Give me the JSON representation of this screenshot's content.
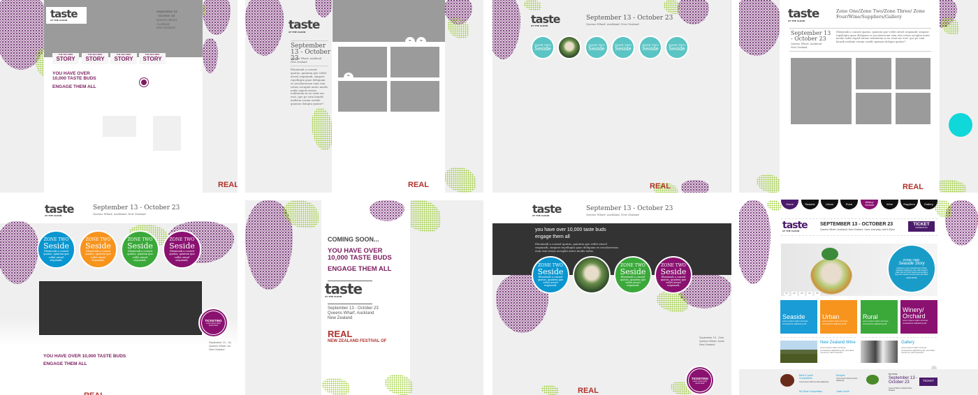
{
  "brand": {
    "logo": "taste",
    "logo_sub": "AT THE CLOUD",
    "real_logo": "REAL",
    "real_sub": "NEW ZEALAND FESTIVAL OF"
  },
  "colors": {
    "purple": "#7b1c5e",
    "blue": "#0a96d0",
    "orange": "#f7941d",
    "green": "#3aa93a",
    "magenta": "#8a1170",
    "teal": "#5bc4c4",
    "dark": "#333333"
  },
  "panel1": {
    "date_lines": [
      "September 13",
      "- October 23",
      "Queens Wharf,",
      "Auckland",
      "New Zealand"
    ],
    "tabs": [
      {
        "small": "THE SEA SIDE",
        "big": "STORY"
      },
      {
        "small": "THE SEA SIDE",
        "big": "STORY"
      },
      {
        "small": "THE SEA SIDE",
        "big": "STORY"
      },
      {
        "small": "THE SEA SIDE",
        "big": "STORY"
      }
    ],
    "headline1": "YOU HAVE OVER",
    "headline2": "10,000 TASTE BUDS",
    "headline3": "ENGAGE THEM ALL"
  },
  "panel2": {
    "date": "September 13 - October 23",
    "location": "Queens Wharf, Auckland New Zealand",
    "body": "Ebeniendi a consed quatus, quiatem que vollet atesel sequiandi, simpost repellupta quae deliquam es necaborerum eum rem rerias acruplat antes modis nobis exped exerae nobitatem in ea venit mo eost, que pe eum latarib melisim eorum eostile quamus dolupta quatur?",
    "pager": [
      "01",
      "02"
    ],
    "grid_label": "01"
  },
  "panel3": {
    "date": "September 13 - October 23",
    "location": "Queens Wharf, Auckland, New Zealand",
    "circles": [
      {
        "zone": "ZONE TWO",
        "name": "Seside"
      },
      {
        "zone": "ZONE TWO",
        "name": "Seside"
      },
      {
        "zone": "ZONE TWO",
        "name": "Seside"
      },
      {
        "zone": "ZONE TWO",
        "name": "Seside"
      },
      {
        "zone": "ZONE TWO",
        "name": "Seside"
      }
    ]
  },
  "panel4": {
    "nav": "Zone One/Zone Two/Zone Three/ Zone Four/Wine/Suppliers/Gallery",
    "date": "September 13 - October 23",
    "location": "Queens Wharf, Auckland New Zealand",
    "body": "Ebeniendi a consed quatus, quiatem que vollet atesel sequiandi, simpost repellupta quae deliquam es necaborerum eum rem rerias acruplat antes modio nobis exped exerae nobitatem in ea venit mo eost, que pe eum latarib melisim eorum eostile quamus dolupta quatur?"
  },
  "panel5": {
    "date": "September 13 - October 23",
    "location": "Queens Wharf, Auckland, New Zealand",
    "circles": [
      {
        "zone": "ZONE TWO",
        "name": "Seside",
        "desc": "Ebeniendi a consed quatus, quiatem que vollet atesel sequiandi,"
      },
      {
        "zone": "ZONE TWO",
        "name": "Seside",
        "desc": "Ebeniendi a consed quatus, quiatem que vollet atesel sequiandi,"
      },
      {
        "zone": "ZONE TWO",
        "name": "Seside",
        "desc": "Ebeniendi a consed quatus, quiatem que vollet atesel sequiandi,"
      },
      {
        "zone": "ZONE TWO",
        "name": "Seside",
        "desc": "Ebeniendi a consed quatus, quiatem que vollet atesel sequiandi,"
      }
    ],
    "ticketing": "TICKETING",
    "ticketing_sub": "Lorem ipsum dolor amunt dolor",
    "side_date": [
      "September 13 - Oc",
      "Queens Wharf, Au",
      "New Zealand"
    ],
    "headline1": "YOU HAVE OVER 10,000 TASTE BUDS",
    "headline2": "ENGAGE THEM ALL"
  },
  "panel6": {
    "coming": "COMING SOON...",
    "headline1": "YOU HAVE OVER",
    "headline2": "10,000 TASTE BUDS",
    "headline3": "ENGAGE THEM ALL",
    "date_lines": [
      "September 13 - October 23",
      "Queens Wharf, Auckland",
      "New Zealand"
    ]
  },
  "panel7": {
    "date": "September 13 - October 23",
    "location": "Queens Wharf, Auckland, New Zealand",
    "headline1": "you have over 10,000 taste buds",
    "headline2": "engage them all",
    "body": "Ebeniendi a consed quatus, quiatem que vollet atesel sequiandi, simpost repellupta quae deliquam es necaborerum eum rem rerias acruplat antes modis nobis.",
    "circles": [
      {
        "zone": "ZONE TWO",
        "name": "Seside",
        "desc": "Ebeniendi a consed quatus, quiatem que vollet atesel sequiandi,"
      },
      {
        "zone": "ZONE TWO",
        "name": "Seside",
        "desc": "Ebeniendi a consed quatus, quiatem que vollet atesel sequiandi,"
      },
      {
        "zone": "ZONE TWO",
        "name": "Seside",
        "desc": "Ebeniendi a consed quatus, quiatem que vollet atesel sequiandi,"
      }
    ],
    "side_date": [
      "September 13 - Octo",
      "Queens Wharf, Auckl",
      "New Zealand"
    ],
    "ticketing": "TICKETING",
    "ticketing_sub": "Lorem ipsum dolor amunt dolor"
  },
  "panel8": {
    "nav": [
      "Home",
      "Seaside",
      "Urban",
      "Rural",
      "Winery/ Orchard",
      "Wine",
      "Suppliers",
      "Gallery"
    ],
    "date": "SEPTEMBER 13 - OCTOBER 23",
    "location": "Queens Wharf, Auckland, New Zealand. Open everyday until 6.30pm",
    "ticket": "TICKET",
    "ticket_sub": "INFORMATION",
    "hero_zone": "ZONE ONE:",
    "hero_title": "Seaside Story",
    "hero_body": "Fishing is a very important part of New Zealand's indigenous story. Maori legend states that our North Island was actually a huge fish, hauled up by the demi god Maui.",
    "hero_more": "READ MORE",
    "slides": [
      "01",
      "02",
      "03",
      "04",
      "05"
    ],
    "tiles": [
      {
        "name": "Seaside",
        "desc": "Lorem ipsum dolor sit amet, consectetur adipiscing elit"
      },
      {
        "name": "Urban",
        "desc": "Lorem ipsum dolor sit amet, consectetur adipiscing elit"
      },
      {
        "name": "Rural",
        "desc": "Lorem ipsum dolor sit amet, consectetur adipiscing elit"
      },
      {
        "name": "Winery/ Orchard",
        "desc": "Lorem ipsum dolor sit amet, consectetur adipiscing elit"
      }
    ],
    "features": [
      {
        "title": "New Zealand Wine",
        "desc": "Lorem ipsum dolor sit amet, consectetur adipiscing elit, sed diam nonummy nibh euismod"
      },
      {
        "title": "Gallery",
        "desc": "Lorem ipsum dolor sit amet, consectetur adipiscing elit, sed diam nonummy nibh euismod"
      }
    ],
    "footer": [
      {
        "title": "Beef & Lamb Competition",
        "desc": "Lorem ipsum dolor sit amet adipiscing"
      },
      {
        "title": "Recipes",
        "desc": "Lorem ipsum dolor sit amet adipiscing"
      },
      {
        "title": "NZ Wine Competition"
      },
      {
        "title": "Justin North"
      }
    ],
    "footer_be": "BE THERE",
    "footer_date": "September 13 - October 23",
    "footer_loc": "Queens Wharf, Auckland New Zealand"
  }
}
